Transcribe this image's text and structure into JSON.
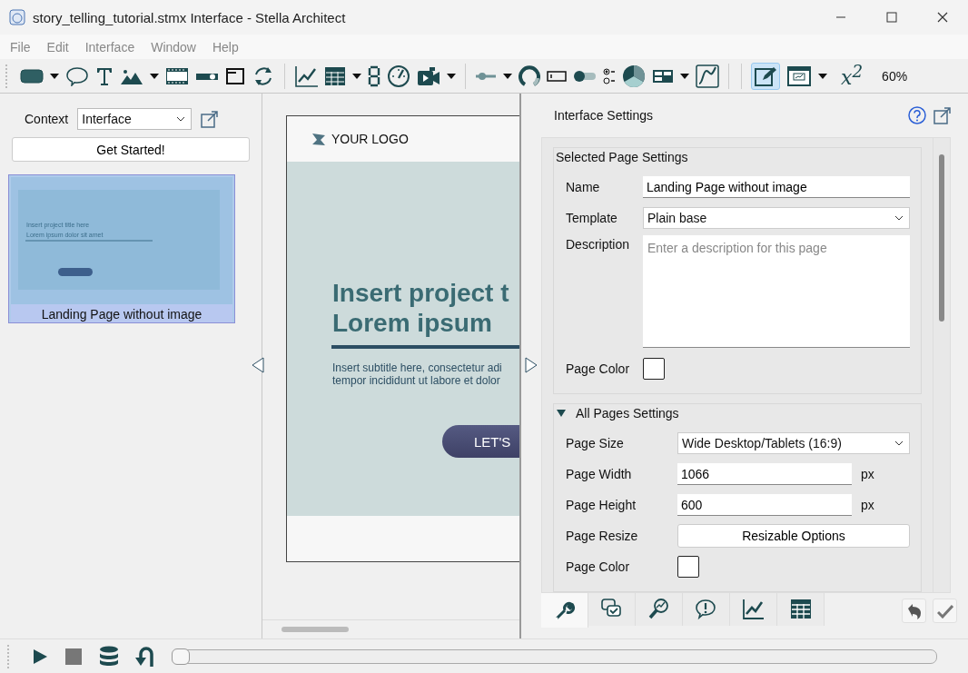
{
  "window": {
    "title": "story_telling_tutorial.stmx Interface - Stella Architect"
  },
  "menu": [
    "File",
    "Edit",
    "Interface",
    "Window",
    "Help"
  ],
  "toolbar": {
    "superscript_label": "x$^{2}$",
    "zoom": "60%",
    "edit_mode_selected": true
  },
  "sidebar": {
    "context_label": "Context",
    "context_value": "Interface",
    "get_started": "Get Started!",
    "pages": [
      {
        "name": "Landing Page without image",
        "selected": true,
        "preview_title": "Insert project title here",
        "preview_subtitle": "Lorem ipsum dolor sit amet"
      }
    ]
  },
  "canvas": {
    "logo": "YOUR LOGO",
    "title_lines": [
      "Insert project t",
      "Lorem ipsum"
    ],
    "subtitle_lines": [
      "Insert subtitle here, consectetur adi",
      "tempor incididunt ut labore et dolor"
    ],
    "button": "LET'S"
  },
  "settings": {
    "title": "Interface Settings",
    "selected_page": {
      "heading": "Selected Page Settings",
      "name_label": "Name",
      "name_value": "Landing Page without image",
      "template_label": "Template",
      "template_value": "Plain base",
      "description_label": "Description",
      "description_placeholder": "Enter a description for this page",
      "color_label": "Page Color"
    },
    "all_pages": {
      "heading": "All Pages Settings",
      "expanded": true,
      "size_label": "Page Size",
      "size_value": "Wide Desktop/Tablets (16:9)",
      "width_label": "Page Width",
      "width_value": "1066",
      "width_unit": "px",
      "height_label": "Page Height",
      "height_value": "600",
      "height_unit": "px",
      "resize_label": "Page Resize",
      "resize_button": "Resizable Options",
      "color_label": "Page Color"
    },
    "tabs": [
      {
        "selected": true
      },
      {
        "selected": false
      },
      {
        "selected": false
      },
      {
        "selected": false
      },
      {
        "selected": false
      },
      {
        "selected": false
      }
    ]
  },
  "timeline": {
    "level": 0
  }
}
